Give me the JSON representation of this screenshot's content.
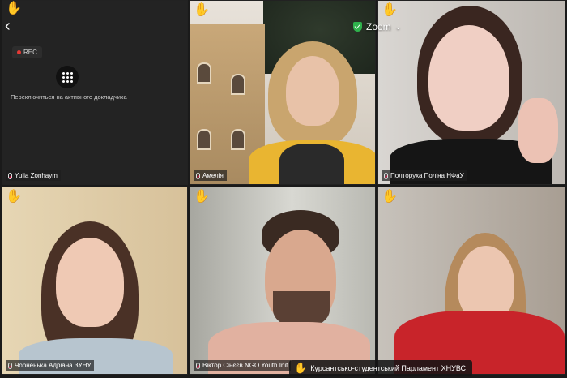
{
  "app": {
    "brand": "Zoom"
  },
  "controls": {
    "back_glyph": "‹",
    "chevron": "⌄",
    "rec_label": "REC",
    "switch_label": "Переключиться на активного докладчика"
  },
  "participants": [
    {
      "name": "Yulia Zonhaym"
    },
    {
      "name": "Амелія"
    },
    {
      "name": "Полторуха Поліна НФаУ"
    },
    {
      "name": "Чорненька Адріана ЗУНУ"
    },
    {
      "name": "Віктор Сінєєв NGO Youth Init"
    },
    {
      "name": "Курсантсько-студентський Парламент ХНУВС"
    }
  ],
  "active_speaker": {
    "name": "Курсантсько-студентський Парламент ХНУВС"
  },
  "colors": {
    "raised_hand": "#f5c518",
    "secure_shield": "#2fb24c",
    "record_dot": "#e53935"
  },
  "icons": [
    "back-icon",
    "shield-icon",
    "grid-icon",
    "raised-hand-icon",
    "microphone-icon"
  ]
}
